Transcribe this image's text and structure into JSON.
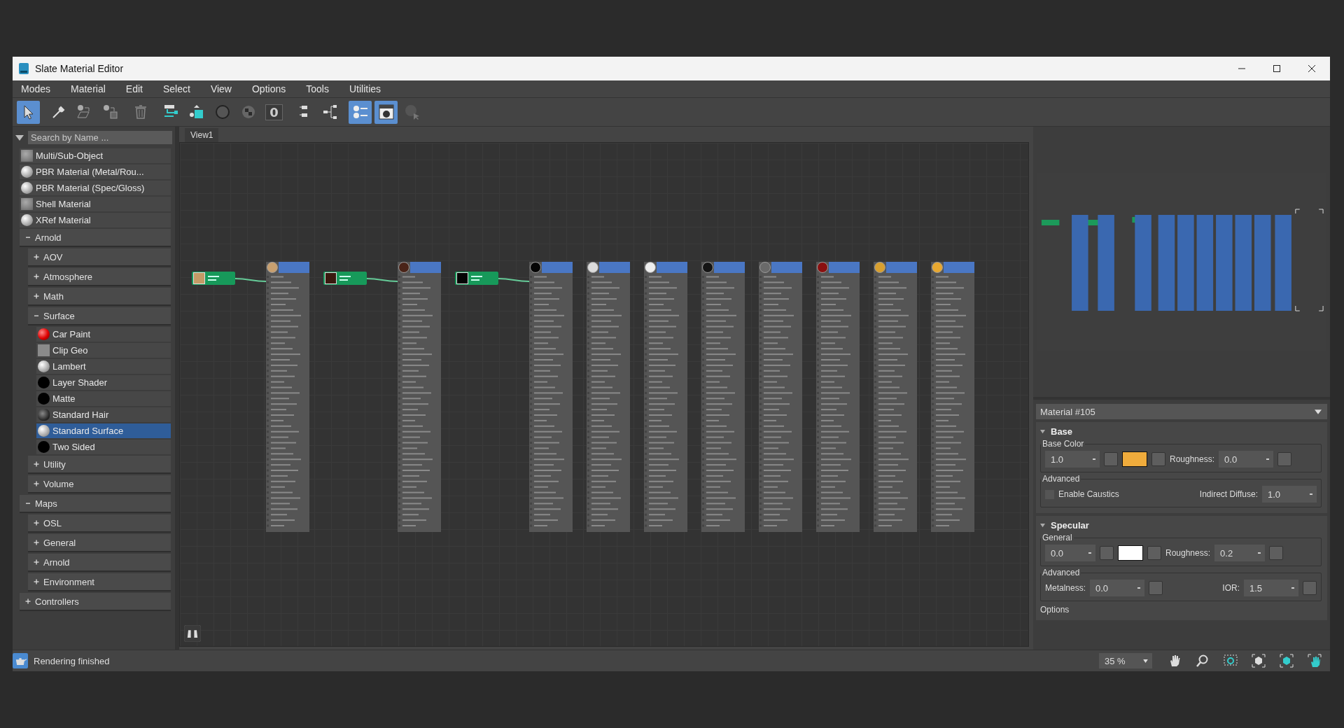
{
  "window": {
    "title": "Slate Material Editor"
  },
  "menu": [
    "Modes",
    "Material",
    "Edit",
    "Select",
    "View",
    "Options",
    "Tools",
    "Utilities"
  ],
  "toolbar": [
    [
      {
        "kind": "arrow",
        "selected": true
      }
    ],
    [
      {
        "kind": "eyedropper",
        "selected": false
      },
      {
        "kind": "assign",
        "selected": false
      },
      {
        "kind": "pick",
        "selected": false
      }
    ],
    [
      {
        "kind": "trash",
        "selected": false
      }
    ],
    [
      {
        "kind": "layout",
        "selected": false
      },
      {
        "kind": "cube",
        "selected": false
      },
      {
        "kind": "sphere",
        "selected": false
      },
      {
        "kind": "checker",
        "selected": false
      },
      {
        "kind": "zero",
        "label": "0",
        "selected": false
      }
    ],
    [
      {
        "kind": "stack",
        "selected": false
      },
      {
        "kind": "tree",
        "selected": false
      }
    ],
    [
      {
        "kind": "list",
        "selected": true
      },
      {
        "kind": "window",
        "selected": true
      },
      {
        "kind": "cursor",
        "selected": false
      }
    ]
  ],
  "browser": {
    "search_placeholder": "Search by Name ...",
    "items": [
      {
        "kind": "material",
        "label": "Multi/Sub-Object",
        "swatch": {
          "kind": "grey"
        },
        "selected": false
      },
      {
        "kind": "material",
        "label": "PBR Material (Metal/Rou...",
        "swatch": {
          "kind": "sphere"
        },
        "selected": false
      },
      {
        "kind": "material",
        "label": "PBR Material (Spec/Gloss)",
        "swatch": {
          "kind": "sphere"
        },
        "selected": false
      },
      {
        "kind": "material",
        "label": "Shell Material",
        "swatch": {
          "kind": "grey"
        },
        "selected": false
      },
      {
        "kind": "material",
        "label": "XRef Material",
        "swatch": {
          "kind": "sphere"
        },
        "selected": false
      },
      {
        "kind": "group",
        "label": "Arnold",
        "expanded": true,
        "children": [
          {
            "kind": "group",
            "label": "AOV",
            "expanded": false
          },
          {
            "kind": "group",
            "label": "Atmosphere",
            "expanded": false
          },
          {
            "kind": "group",
            "label": "Math",
            "expanded": false
          },
          {
            "kind": "group",
            "label": "Surface",
            "expanded": true,
            "children": [
              {
                "kind": "material",
                "label": "Car Paint",
                "swatch": {
                  "kind": "red"
                },
                "selected": false
              },
              {
                "kind": "material",
                "label": "Clip Geo",
                "swatch": {
                  "kind": "flat"
                },
                "selected": false
              },
              {
                "kind": "material",
                "label": "Lambert",
                "swatch": {
                  "kind": "sphere"
                },
                "selected": false
              },
              {
                "kind": "material",
                "label": "Layer Shader",
                "swatch": {
                  "kind": "black"
                },
                "selected": false
              },
              {
                "kind": "material",
                "label": "Matte",
                "swatch": {
                  "kind": "black"
                },
                "selected": false
              },
              {
                "kind": "material",
                "label": "Standard Hair",
                "swatch": {
                  "kind": "hair"
                },
                "selected": false
              },
              {
                "kind": "material",
                "label": "Standard Surface",
                "swatch": {
                  "kind": "sphere"
                },
                "selected": true
              },
              {
                "kind": "material",
                "label": "Two Sided",
                "swatch": {
                  "kind": "black"
                },
                "selected": false
              }
            ]
          },
          {
            "kind": "group",
            "label": "Utility",
            "expanded": false
          },
          {
            "kind": "group",
            "label": "Volume",
            "expanded": false
          }
        ]
      },
      {
        "kind": "group",
        "label": "Maps",
        "expanded": true,
        "children": [
          {
            "kind": "group",
            "label": "OSL",
            "expanded": false
          },
          {
            "kind": "group",
            "label": "General",
            "expanded": false
          },
          {
            "kind": "group",
            "label": "Arnold",
            "expanded": false
          },
          {
            "kind": "group",
            "label": "Environment",
            "expanded": false
          }
        ]
      },
      {
        "kind": "group",
        "label": "Controllers",
        "expanded": false
      }
    ]
  },
  "view": {
    "tab": "View1",
    "nodes": [
      {
        "color": "#c8a070",
        "map": {
          "color": "#c49a66"
        }
      },
      {
        "color": "#4a2418",
        "map": {
          "color": "#3a1a10"
        }
      },
      {
        "color": "#050505",
        "map": {
          "color": "#050505"
        }
      },
      {
        "color": "#dcdcdc"
      },
      {
        "color": "#eeeeee"
      },
      {
        "color": "#151515"
      },
      {
        "color": "#6a6a6a"
      },
      {
        "color": "#8a1010"
      },
      {
        "color": "#d8a030"
      },
      {
        "color": "#e8a830"
      }
    ]
  },
  "parameters": {
    "material": "Material #105",
    "base": {
      "title": "Base",
      "expanded": true,
      "color_label": "Base Color",
      "weight": "1.0",
      "color": "#f0ac3c",
      "roughness_label": "Roughness:",
      "roughness": "0.0",
      "advanced_label": "Advanced",
      "caustics_label": "Enable Caustics",
      "caustics_checked": false,
      "indirect_label": "Indirect Diffuse:",
      "indirect": "1.0"
    },
    "specular": {
      "title": "Specular",
      "expanded": true,
      "general_label": "General",
      "weight": "0.0",
      "color": "#ffffff",
      "roughness_label": "Roughness:",
      "roughness": "0.2",
      "advanced_label": "Advanced",
      "metalness_label": "Metalness:",
      "metalness": "0.0",
      "ior_label": "IOR:",
      "ior": "1.5",
      "options_label": "Options"
    }
  },
  "status_bar": {
    "message": "Rendering finished",
    "zoom": "35 %",
    "tools": [
      {
        "kind": "hand"
      },
      {
        "kind": "zoom"
      },
      {
        "kind": "zoom-region"
      },
      {
        "kind": "extents"
      },
      {
        "kind": "extents-selected"
      },
      {
        "kind": "pan-selected"
      }
    ]
  }
}
